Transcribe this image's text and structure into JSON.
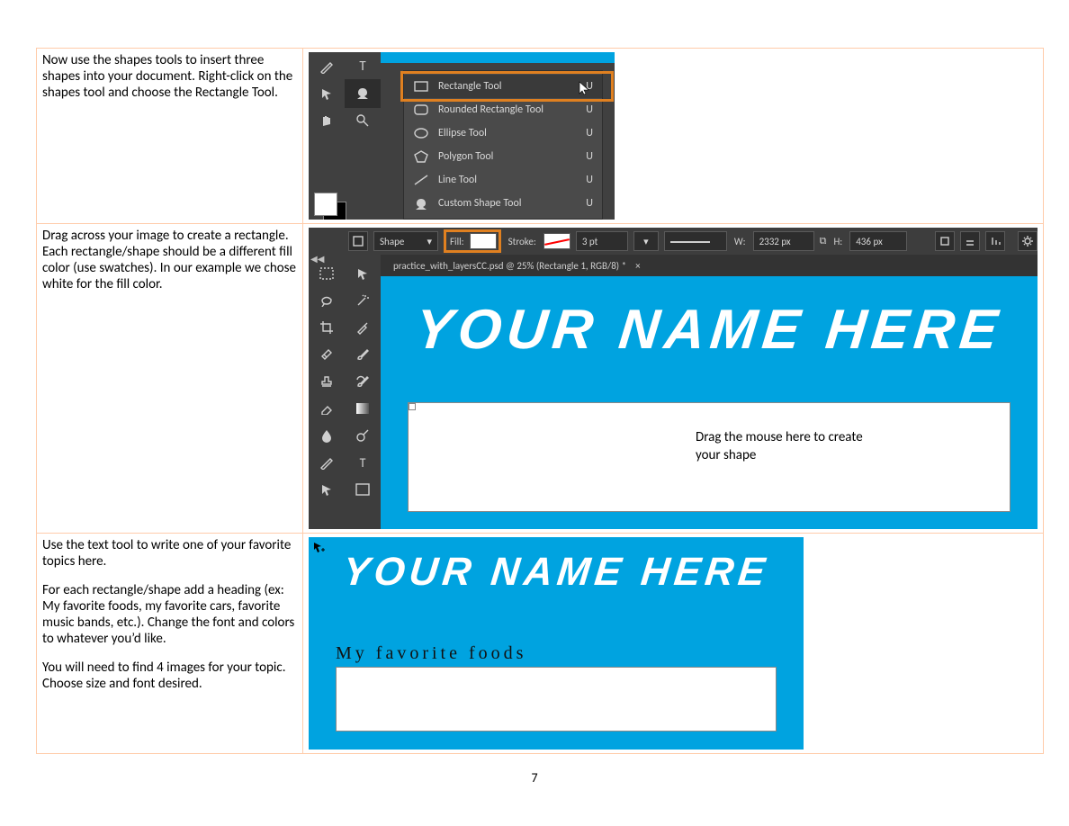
{
  "page_number": "7",
  "row1": {
    "instruction": "Now use the shapes tools to insert three shapes into your document. Right-click on the shapes tool and choose the Rectangle Tool.",
    "flyout": {
      "rectangle": "Rectangle Tool",
      "rounded": "Rounded Rectangle Tool",
      "ellipse": "Ellipse Tool",
      "polygon": "Polygon Tool",
      "line": "Line Tool",
      "custom": "Custom Shape Tool",
      "kbd": "U"
    }
  },
  "row2": {
    "instruction": "Drag across your image to create a rectangle. Each rectangle/shape should be a different fill color (use swatches). In our example we chose white for the fill color.",
    "optionsbar": {
      "mode": "Shape",
      "fill_label": "Fill:",
      "stroke_label": "Stroke:",
      "stroke_pt": "3 pt",
      "w_label": "W:",
      "w_val": "2332 px",
      "h_label": "H:",
      "h_val": "436 px"
    },
    "tab": "practice_with_layersCC.psd @ 25% (Rectangle 1, RGB/8) *",
    "bigtext": "YOUR NAME HERE",
    "hint": "Drag the mouse here to create your shape"
  },
  "row3": {
    "instruction_a": "Use the text tool to write one of your favorite topics here.",
    "instruction_b": "For each rectangle/shape add a heading (ex: My favorite foods, my favorite cars, favorite music bands, etc.).  Change the font and colors to whatever you’d like.",
    "instruction_c": "You will need to find 4 images for your topic. Choose size and font desired.",
    "bigtext": "YOUR NAME HERE",
    "heading": "My favorite foods"
  }
}
